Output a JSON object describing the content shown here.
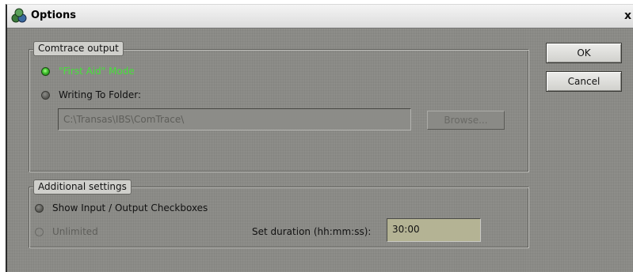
{
  "window": {
    "title": "Options",
    "close_label": "x"
  },
  "comtrace": {
    "legend": "Comtrace output",
    "first_aid_label": "\"First Aid\" Mode",
    "first_aid_selected": true,
    "writing_label": "Writing To Folder:",
    "writing_selected": false,
    "folder_path": "C:\\Transas\\IBS\\ComTrace\\",
    "browse_label": "Browse..."
  },
  "additional": {
    "legend": "Additional settings",
    "show_io_label": "Show Input / Output Checkboxes",
    "unlimited_label": "Unlimited",
    "duration_label": "Set duration (hh:mm:ss):",
    "duration_value": "30:00"
  },
  "buttons": {
    "ok_label": "OK",
    "cancel_label": "Cancel"
  },
  "colors": {
    "selected_option_text": "#46e03a",
    "dialog_background": "#8a8a86",
    "duration_field": "#b4b394"
  }
}
